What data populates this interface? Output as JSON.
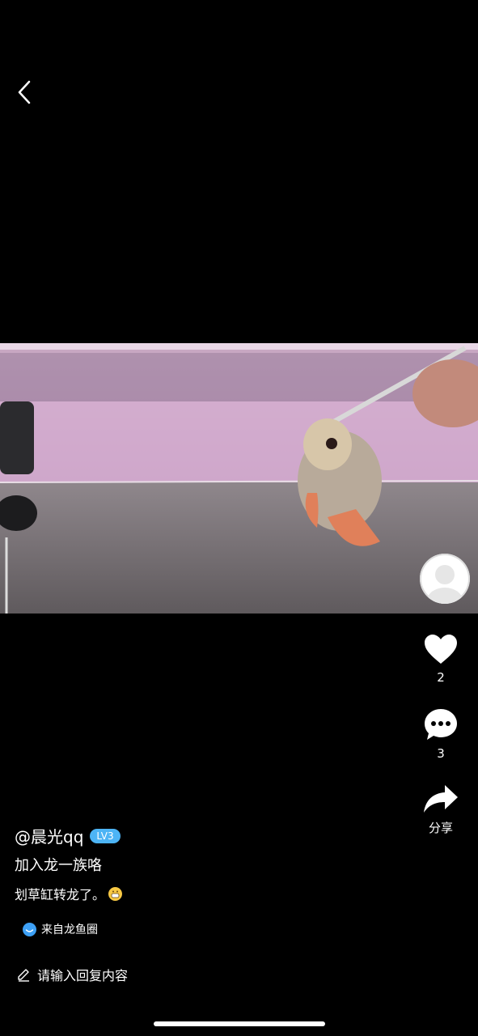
{
  "nav": {
    "back_icon": "chevron-left-icon"
  },
  "video": {
    "description": "aquarium with arowana fish being fed with tweezers"
  },
  "actions": {
    "like_count": "2",
    "comment_count": "3",
    "share_label": "分享"
  },
  "post": {
    "username": "@晨光qq",
    "level": "LV3",
    "title": "加入龙一族咯",
    "description": "划草缸转龙了。",
    "source": "来自龙鱼圈"
  },
  "reply": {
    "placeholder": "请输入回复内容"
  },
  "colors": {
    "badge": "#4db4f5",
    "circle": "#3da0f5",
    "background": "#000000"
  }
}
